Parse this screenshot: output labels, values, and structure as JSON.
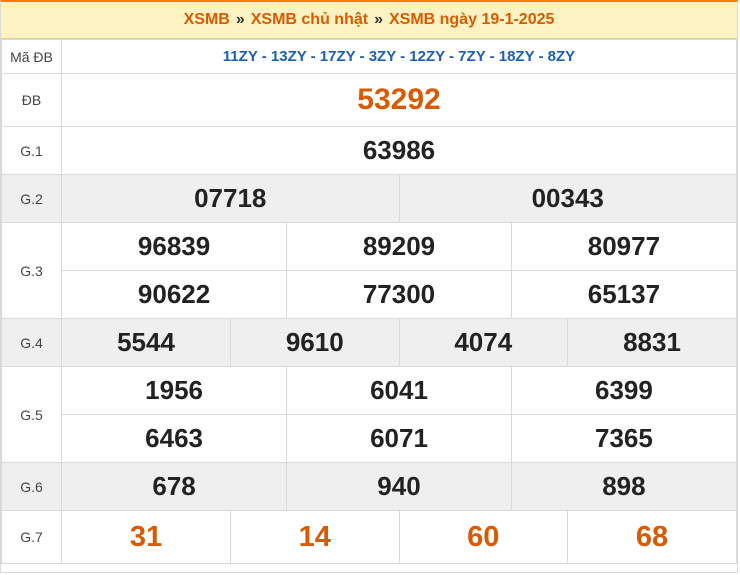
{
  "header": {
    "crumb1": "XSMB",
    "crumb2": "XSMB chủ nhật",
    "crumb3": "XSMB ngày 19-1-2025",
    "separator": "»"
  },
  "rows": {
    "madb": {
      "label": "Mã ĐB",
      "value": "11ZY - 13ZY - 17ZY - 3ZY - 12ZY - 7ZY - 18ZY - 8ZY"
    },
    "db": {
      "label": "ĐB",
      "values": [
        "53292"
      ]
    },
    "g1": {
      "label": "G.1",
      "values": [
        "63986"
      ]
    },
    "g2": {
      "label": "G.2",
      "values": [
        "07718",
        "00343"
      ]
    },
    "g3": {
      "label": "G.3",
      "values": [
        "96839",
        "89209",
        "80977",
        "90622",
        "77300",
        "65137"
      ]
    },
    "g4": {
      "label": "G.4",
      "values": [
        "5544",
        "9610",
        "4074",
        "8831"
      ]
    },
    "g5": {
      "label": "G.5",
      "values": [
        "1956",
        "6041",
        "6399",
        "6463",
        "6071",
        "7365"
      ]
    },
    "g6": {
      "label": "G.6",
      "values": [
        "678",
        "940",
        "898"
      ]
    },
    "g7": {
      "label": "G.7",
      "values": [
        "31",
        "14",
        "60",
        "68"
      ]
    }
  },
  "colors": {
    "accent": "#d95a00",
    "header_bg": "#fdf3c2",
    "code_blue": "#1a5fb4",
    "alt_row": "#efefef"
  }
}
